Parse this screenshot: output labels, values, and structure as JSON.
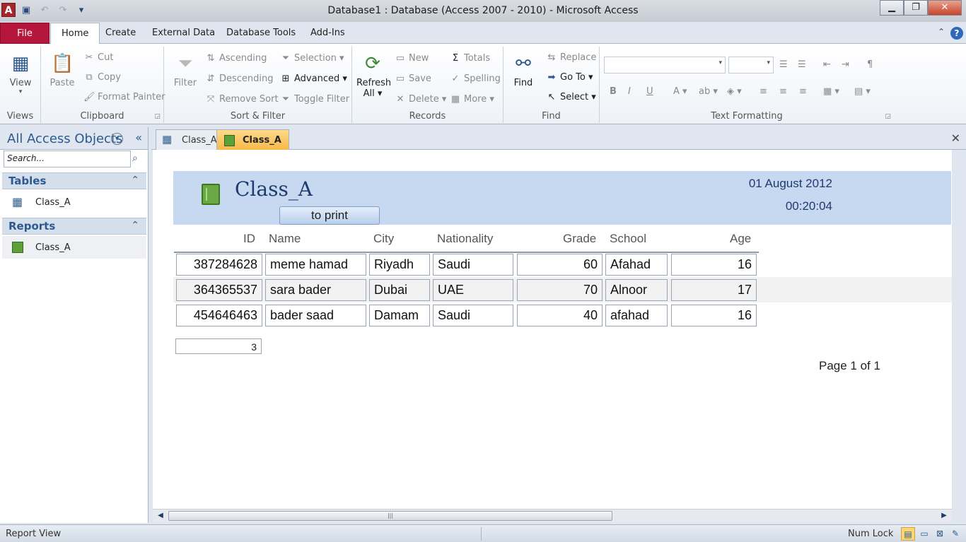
{
  "window": {
    "title": "Database1 : Database (Access 2007 - 2010)  -  Microsoft Access",
    "app_icon_letter": "A",
    "controls": {
      "minimize": "▁",
      "restore": "❐",
      "close": "✕"
    }
  },
  "quick_access": {
    "items": [
      {
        "name": "save-icon",
        "glyph": "💾"
      },
      {
        "name": "undo-icon",
        "glyph": "↶"
      },
      {
        "name": "redo-icon",
        "glyph": "↷"
      },
      {
        "name": "customize-qat-icon",
        "glyph": "▾"
      }
    ]
  },
  "ribbon_tabs": [
    "File",
    "Home",
    "Create",
    "External Data",
    "Database Tools",
    "Add-Ins"
  ],
  "active_tab": "Home",
  "ribbon": {
    "views": {
      "label": "Views",
      "view": "View"
    },
    "clipboard": {
      "label": "Clipboard",
      "paste": "Paste",
      "cut": "Cut",
      "copy": "Copy",
      "format_painter": "Format Painter"
    },
    "sort_filter": {
      "label": "Sort & Filter",
      "filter": "Filter",
      "ascending": "Ascending",
      "descending": "Descending",
      "remove_sort": "Remove Sort",
      "selection": "Selection",
      "advanced": "Advanced",
      "toggle_filter": "Toggle Filter"
    },
    "records": {
      "label": "Records",
      "refresh": "Refresh",
      "refresh_all": "All",
      "new": "New",
      "save": "Save",
      "delete": "Delete",
      "totals": "Totals",
      "spelling": "Spelling",
      "more": "More"
    },
    "find": {
      "label": "Find",
      "find": "Find",
      "replace": "Replace",
      "goto": "Go To",
      "select": "Select"
    },
    "text_formatting": {
      "label": "Text Formatting",
      "bold": "B",
      "italic": "I",
      "underline": "U"
    }
  },
  "nav_pane": {
    "title": "All Access Objects",
    "search_placeholder": "Search...",
    "sections": [
      {
        "title": "Tables",
        "items": [
          "Class_A"
        ]
      },
      {
        "title": "Reports",
        "items": [
          "Class_A"
        ]
      }
    ]
  },
  "doc_tabs": [
    {
      "label": "Class_A",
      "kind": "table",
      "active": false
    },
    {
      "label": "Class_A",
      "kind": "report",
      "active": true
    }
  ],
  "report": {
    "title": "Class_A",
    "print_button": "to print",
    "date": "01 August 2012",
    "time": "00:20:04",
    "columns": [
      "ID",
      "Name",
      "City",
      "Nationality",
      "Grade",
      "School",
      "Age"
    ],
    "rows": [
      [
        "387284628",
        "meme hamad",
        "Riyadh",
        "Saudi",
        "60",
        "Afahad",
        "16"
      ],
      [
        "364365537",
        "sara bader",
        "Dubai",
        "UAE",
        "70",
        "Alnoor",
        "17"
      ],
      [
        "454646463",
        "bader saad",
        "Damam",
        "Saudi",
        "40",
        "afahad",
        "16"
      ]
    ],
    "record_count": "3",
    "page_text": "Page 1 of 1"
  },
  "status_bar": {
    "left": "Report View",
    "right": "Num Lock"
  },
  "colors": {
    "file_tab": "#b4173b",
    "report_header": "#c6d9f1",
    "active_doc_tab": "#f5b94a"
  }
}
